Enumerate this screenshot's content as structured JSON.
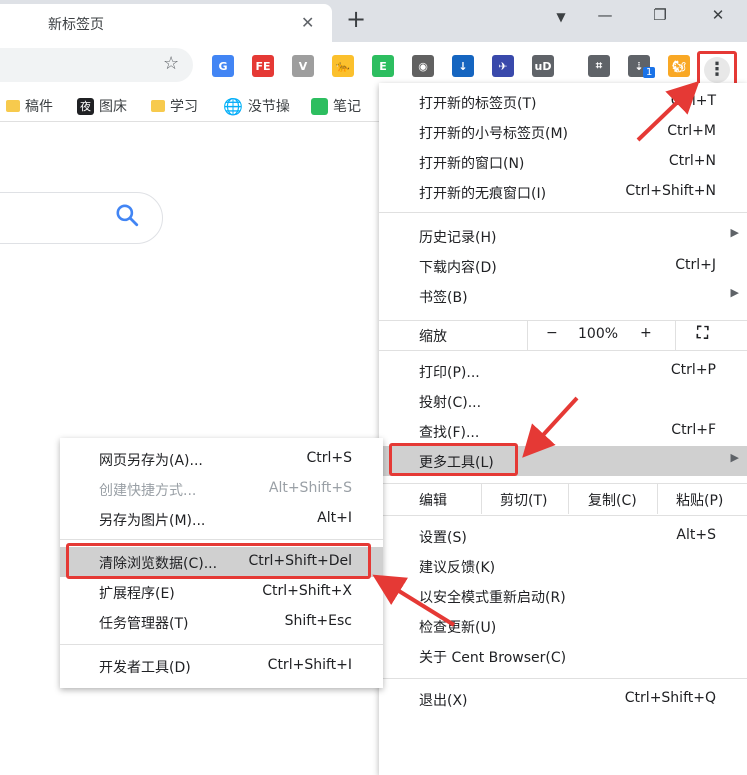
{
  "tab": {
    "title": "新标签页"
  },
  "window": {
    "close_tab": "✕",
    "new_tab": "+",
    "minimize": "—",
    "restore": "❐",
    "close": "✕"
  },
  "toolbar": {
    "extensions": [
      {
        "name": "google-translate-icon",
        "text": "G",
        "color": "#4285f4"
      },
      {
        "name": "fe-helper-icon",
        "text": "FE",
        "color": "#e53935"
      },
      {
        "name": "vue-devtools-icon",
        "text": "V",
        "color": "#9e9e9e"
      },
      {
        "name": "tampermonkey-icon",
        "text": "🐆",
        "color": "#fbc02d"
      },
      {
        "name": "evernote-icon",
        "text": "E",
        "color": "#2dbe60"
      },
      {
        "name": "ext-mask-icon",
        "text": "◉",
        "color": "#616161"
      },
      {
        "name": "download-ext-icon",
        "text": "↓",
        "color": "#1565c0"
      },
      {
        "name": "bird-icon",
        "text": "✈",
        "color": "#3949ab"
      },
      {
        "name": "ublock-icon",
        "text": "uD",
        "color": "#5f6368"
      },
      {
        "name": "crop-icon",
        "text": "⌗",
        "color": "#5f6368"
      },
      {
        "name": "extension-badge-icon",
        "text": "⇣",
        "color": "#5f6368"
      },
      {
        "name": "avatar-icon",
        "text": "🐿",
        "color": "#f9a825"
      }
    ],
    "badge": "1",
    "menu_dots": "⋮"
  },
  "bookmarks": [
    {
      "label": "稿件",
      "type": "folder"
    },
    {
      "label": "图床",
      "type": "site",
      "icon": "夜"
    },
    {
      "label": "学习",
      "type": "folder"
    },
    {
      "label": "没节操",
      "type": "globe"
    },
    {
      "label": "笔记",
      "type": "evernote"
    }
  ],
  "main_menu": {
    "new_tab": {
      "label": "打开新的标签页(T)",
      "shortcut": "Ctrl+T"
    },
    "new_small_tab": {
      "label": "打开新的小号标签页(M)",
      "shortcut": "Ctrl+M"
    },
    "new_window": {
      "label": "打开新的窗口(N)",
      "shortcut": "Ctrl+N"
    },
    "incognito": {
      "label": "打开新的无痕窗口(I)",
      "shortcut": "Ctrl+Shift+N"
    },
    "history": {
      "label": "历史记录(H)"
    },
    "downloads": {
      "label": "下载内容(D)",
      "shortcut": "Ctrl+J"
    },
    "bookmarks": {
      "label": "书签(B)"
    },
    "zoom": {
      "label": "缩放",
      "minus": "−",
      "value": "100%",
      "plus": "+"
    },
    "print": {
      "label": "打印(P)...",
      "shortcut": "Ctrl+P"
    },
    "cast": {
      "label": "投射(C)..."
    },
    "find": {
      "label": "查找(F)...",
      "shortcut": "Ctrl+F"
    },
    "more_tools": {
      "label": "更多工具(L)"
    },
    "edit": {
      "label": "编辑",
      "cut": "剪切(T)",
      "copy": "复制(C)",
      "paste": "粘贴(P)"
    },
    "settings": {
      "label": "设置(S)",
      "shortcut": "Alt+S"
    },
    "feedback": {
      "label": "建议反馈(K)"
    },
    "safe_mode": {
      "label": "以安全模式重新启动(R)"
    },
    "check_update": {
      "label": "检查更新(U)"
    },
    "about": {
      "label": "关于 Cent Browser(C)"
    },
    "exit": {
      "label": "退出(X)",
      "shortcut": "Ctrl+Shift+Q"
    }
  },
  "sub_menu": {
    "save_as": {
      "label": "网页另存为(A)...",
      "shortcut": "Ctrl+S"
    },
    "create_shortcut": {
      "label": "创建快捷方式...",
      "shortcut": "Alt+Shift+S"
    },
    "save_image": {
      "label": "另存为图片(M)...",
      "shortcut": "Alt+I"
    },
    "clear_data": {
      "label": "清除浏览数据(C)...",
      "shortcut": "Ctrl+Shift+Del"
    },
    "extensions": {
      "label": "扩展程序(E)",
      "shortcut": "Ctrl+Shift+X"
    },
    "task_manager": {
      "label": "任务管理器(T)",
      "shortcut": "Shift+Esc"
    },
    "devtools": {
      "label": "开发者工具(D)",
      "shortcut": "Ctrl+Shift+I"
    }
  },
  "colors": {
    "highlight_box": "#e53935",
    "hover": "#d0d0d0",
    "accent": "#4285f4"
  }
}
